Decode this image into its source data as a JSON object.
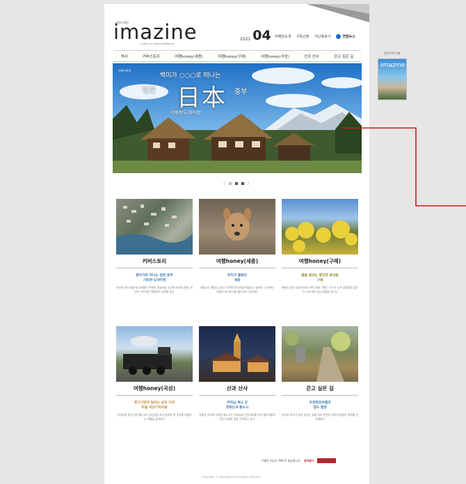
{
  "header": {
    "brand_small": "연합이매진",
    "logo": "imazine",
    "logo_sub": "Culture & Leisure Magazine",
    "issue_year": "2021",
    "issue_num": "04",
    "top_links": [
      "이매진소개",
      "구독신청",
      "지난호보기"
    ],
    "yonhap_logo": "연합뉴스"
  },
  "nav": {
    "items": [
      "역사",
      "커버스토리",
      "여행honey(세종)",
      "여행honey(구례)",
      "여행honey(곡성)",
      "산과 산사",
      "걷고 싶은 길"
    ]
  },
  "hero": {
    "tag": "커버스토리",
    "line1": "백미가 ○○○로 떠나는",
    "jp": "일본",
    "big": "日本",
    "chubu": "중부",
    "bottom": "기후현도야마현"
  },
  "pager": {
    "prev": "〈",
    "next": "〉"
  },
  "cards": [
    {
      "title": "커버스토리",
      "sub1": "편미가로 떠나는 일본 중부",
      "sub2": "기후현·도야마현",
      "sub_color": "#3d7ab8",
      "desc": "지리적 위치 때문에 사계절이 뚜렷한 중부지방 곳곳에 역사와 전통, 자연이 어우러진 여행지가 산재해 있다"
    },
    {
      "title": "여행honey(세종)",
      "sub1": "우리가 몰랐던",
      "sub2": "세종",
      "sub_color": "#3d7ab8",
      "desc": "세종시는 행정도시라는 딱딱한 이미지를 떠올리기 쉽지만 그 안에는 의외로 아기자기한 볼거리가 가득하다"
    },
    {
      "title": "여행honey(구례)",
      "sub1": "봄을 알리는 향긋한 꽃내음",
      "sub2": "구례",
      "sub_color": "#8a8a2a",
      "desc": "해마다 봄이 오면 지리산 자락 아래 구례는 산수유 노란 꽃물결로 물든다 고즈넉한 산골 마을을 걷는다"
    },
    {
      "title": "여행honey(곡성)",
      "sub1": "증기기관차 달리는 낭만 기차",
      "sub2": "마을 곡성기차마을",
      "sub_color": "#c2883a",
      "desc": "기차마을 증기기관차를 타고 섬진강을 따라 달리며 옛 추억을 떠올리는 여행을 즐겨본다"
    },
    {
      "title": "산과 산사",
      "sub1": "부처님 계신 곳",
      "sub2": "영축산과 통도사",
      "sub_color": "#3d7ab8",
      "desc": "영축산 자락에 자리한 통도사는 부처님의 진신사리를 모신 불보사찰로 천년 고찰의 멋을 간직하고 있다"
    },
    {
      "title": "걷고 싶은 길",
      "sub1": "우정청정호텔과",
      "sub2": "청도 팔경",
      "sub_color": "#3d7ab8",
      "desc": "자연과 역사가 살아 숨쉬는 길을 따라 천천히 걸으며 봄날의 정취를 만끽해본다"
    }
  ],
  "footer": {
    "note": "이매진 지나는 PDF로 제공됩니다.",
    "download": "뷰어받기",
    "adobe": "Get Adobe",
    "copyright": "Copyright © YonhapNews All rights reserved"
  },
  "side": {
    "label": "정기구독 신청",
    "thumb_logo": "imazine"
  },
  "colors": {
    "accent_red": "#c0202a",
    "brand_blue": "#1c6fd1"
  }
}
